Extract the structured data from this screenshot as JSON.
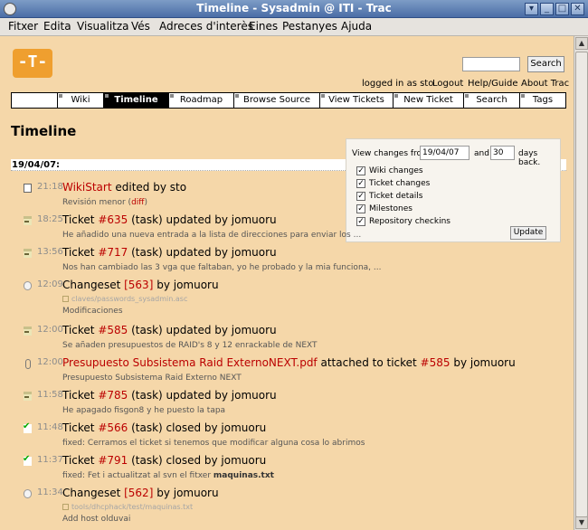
{
  "window": {
    "title": "Timeline - Sysadmin @ ITI - Trac",
    "buttons": [
      "▾",
      "_",
      "□",
      "✕"
    ]
  },
  "menubar": {
    "items": [
      {
        "label": "Fitxer"
      },
      {
        "label": "Edita"
      },
      {
        "label": "Visualitza"
      },
      {
        "label": "Vés"
      },
      {
        "label": "Adreces d'interès"
      },
      {
        "label": "Eines"
      },
      {
        "label": "Pestanyes"
      },
      {
        "label": "Ajuda"
      }
    ]
  },
  "header": {
    "logo_text": "-T-",
    "search_button": "Search",
    "search_value": "",
    "logged_in": "logged in as sto",
    "metanav": [
      "Logout",
      "Help/Guide",
      "About Trac"
    ]
  },
  "mainnav": {
    "tabs": [
      {
        "label": ""
      },
      {
        "label": "Wiki"
      },
      {
        "label": "Timeline",
        "active": true
      },
      {
        "label": "Roadmap"
      },
      {
        "label": "Browse Source"
      },
      {
        "label": "View Tickets"
      },
      {
        "label": "New Ticket"
      },
      {
        "label": "Search"
      },
      {
        "label": "Tags"
      }
    ]
  },
  "page": {
    "title": "Timeline",
    "date_heading": "19/04/07:"
  },
  "prefs": {
    "view_changes_from": "View changes from",
    "from_value": "19/04/07",
    "and": "and",
    "days_value": "30",
    "days_back": "days back.",
    "filters": [
      {
        "label": "Wiki changes",
        "checked": true
      },
      {
        "label": "Ticket changes",
        "checked": true
      },
      {
        "label": "Ticket details",
        "checked": true
      },
      {
        "label": "Milestones",
        "checked": true
      },
      {
        "label": "Repository checkins",
        "checked": true
      }
    ],
    "update_button": "Update"
  },
  "events": [
    {
      "icon": "wiki",
      "time": "21:18",
      "link1": "WikiStart",
      "text1": " edited by sto",
      "desc_pre": "Revisión menor (",
      "desc_link": "diff",
      "desc_post": ")"
    },
    {
      "icon": "ticket",
      "time": "18:25",
      "pre": "Ticket ",
      "link1": "#635",
      "text1": " (task) updated by jomuoru",
      "desc": "He añadido una nueva entrada a la lista de direcciones para enviar los ..."
    },
    {
      "icon": "ticket",
      "time": "13:56",
      "pre": "Ticket ",
      "link1": "#717",
      "text1": " (task) updated by jomuoru",
      "desc": "Nos han cambiado las 3 vga que faltaban, yo he probado y la mia funciona, ..."
    },
    {
      "icon": "changeset",
      "time": "12:09",
      "pre": "Changeset ",
      "link1": "[563]",
      "text1": " by jomuoru",
      "file": "claves/passwords_sysadmin.asc",
      "desc": "Modificaciones"
    },
    {
      "icon": "ticket",
      "time": "12:00",
      "pre": "Ticket ",
      "link1": "#585",
      "text1": " (task) updated by jomuoru",
      "desc": "Se añaden presupuestos de RAID's 8 y 12 enrackable de NEXT"
    },
    {
      "icon": "attach",
      "time": "12:00",
      "link1": "Presupuesto Subsistema Raid ExternoNEXT.pdf",
      "text1": " attached to ticket ",
      "link2": "#585",
      "text2": " by jomuoru",
      "desc": "Presupuesto Subsistema Raid Externo NEXT"
    },
    {
      "icon": "ticket",
      "time": "11:58",
      "pre": "Ticket ",
      "link1": "#785",
      "text1": " (task) updated by jomuoru",
      "desc": "He apagado fisgon8 y he puesto la tapa"
    },
    {
      "icon": "closed",
      "time": "11:48",
      "pre": "Ticket ",
      "link1": "#566",
      "text1": " (task) closed by jomuoru",
      "desc": "fixed: Cerramos el ticket si tenemos que modificar alguna cosa lo abrimos"
    },
    {
      "icon": "closed",
      "time": "11:37",
      "pre": "Ticket ",
      "link1": "#791",
      "text1": " (task) closed by jomuoru",
      "desc_pre": "fixed: Fet i actualitzat al svn el fitxer ",
      "desc_bold": "maquinas.txt"
    },
    {
      "icon": "changeset",
      "time": "11:34",
      "pre": "Changeset ",
      "link1": "[562]",
      "text1": " by jomuoru",
      "file": "tools/dhcphack/test/maquinas.txt",
      "desc": "Add host olduvai"
    }
  ]
}
